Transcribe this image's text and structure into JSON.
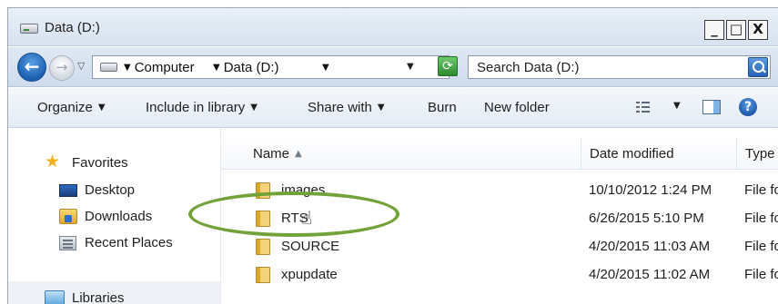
{
  "window": {
    "title": "Data (D:)",
    "buttons": {
      "minimize": "_",
      "maximize": "□",
      "close": "X"
    }
  },
  "address_bar": {
    "breadcrumbs": [
      "Computer",
      "Data (D:)"
    ],
    "search_placeholder": "Search Data (D:)"
  },
  "toolbar": {
    "organize": "Organize",
    "include_in_library": "Include in library",
    "share_with": "Share with",
    "burn": "Burn",
    "new_folder": "New folder",
    "help": "?"
  },
  "navigation": {
    "favorites": "Favorites",
    "items": [
      {
        "label": "Desktop",
        "icon": "desktop-icon"
      },
      {
        "label": "Downloads",
        "icon": "downloads-icon"
      },
      {
        "label": "Recent Places",
        "icon": "recent-places-icon"
      }
    ],
    "libraries": "Libraries"
  },
  "columns": {
    "name": "Name",
    "date_modified": "Date modified",
    "type": "Type"
  },
  "files": [
    {
      "name": "images",
      "date": "10/10/2012 1:24 PM",
      "type": "File fo"
    },
    {
      "name": "RTS",
      "date": "6/26/2015 5:10 PM",
      "type": "File fo"
    },
    {
      "name": "SOURCE",
      "date": "4/20/2015 11:03 AM",
      "type": "File fo"
    },
    {
      "name": "xpupdate",
      "date": "4/20/2015 11:02 AM",
      "type": "File fo"
    }
  ],
  "colors": {
    "highlight_ellipse": "#73a23a",
    "folder": "#f3d27a"
  }
}
